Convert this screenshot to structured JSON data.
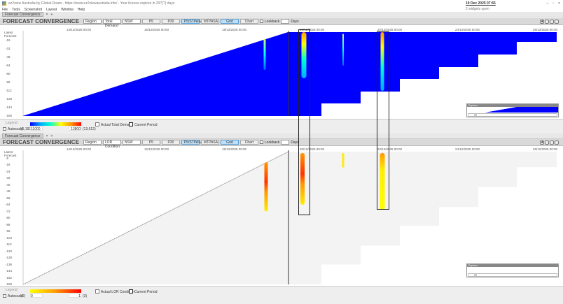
{
  "window": {
    "title": "ez2view Australia by Global-Roam - https://www.ez2viewaustralia.info/ - Your licence expires in 29?(?) days",
    "datetime": "19 Dec 2025 07:55",
    "widgets_open": "2 widgets open"
  },
  "menu": [
    "File",
    "Tools",
    "Screenshot",
    "Layout",
    "Window",
    "Help"
  ],
  "tabs": {
    "label": "Forecast Convergence",
    "active": "Forecast Convergence"
  },
  "panels": [
    {
      "title": "FORECAST CONVERGENCE",
      "region": "Region",
      "measure": "Total Demand",
      "state": "NSW",
      "buttons": [
        "P5",
        "P30",
        "P5/STPASA",
        "MTPASA"
      ],
      "active_button": "P5/STPASA",
      "view": [
        "Grid",
        "Chart"
      ],
      "active_view": "Grid",
      "lookback": "Lookback",
      "lookback_unit": "Days",
      "y_title": "Latest Forecast",
      "y_ticks": [
        "-16",
        "-32",
        "-48",
        "-64",
        "-80",
        "-96",
        "-112",
        "-128",
        "-144",
        "-160"
      ],
      "x_ticks": [
        "14/12/2025 00:00",
        "16/12/2025 00:00",
        "18/12/2025 00:00",
        "20/12/2025 00:00",
        "22/12/2025 00:00",
        "24/12/2025 00:00",
        "26/12/2025 00:00"
      ],
      "legend": {
        "title": "Legend",
        "autoscale": "Autoscale",
        "min_paren": "(5,193)",
        "min": "11000",
        "max": "13800",
        "max_paren": "(13,612)",
        "actual": "Actual Total Demand",
        "current": "Current Period",
        "colors": [
          "#0000ff",
          "#00ffff",
          "#ffff00",
          "#ff0000"
        ]
      },
      "explorer": "Explorer"
    },
    {
      "title": "FORECAST CONVERGENCE",
      "region": "Region",
      "measure": "LOR Condition",
      "state": "NSW",
      "buttons": [
        "P5",
        "P30",
        "P5/STPASA",
        "MTPASA"
      ],
      "active_button": "P5/STPASA",
      "view": [
        "Grid",
        "Chart"
      ],
      "active_view": "Grid",
      "lookback": "Lookback",
      "lookback_unit": "Days",
      "y_title": "Latest Forecast",
      "y_ticks": [
        "-8",
        "-16",
        "-24",
        "-32",
        "-40",
        "-48",
        "-56",
        "-64",
        "-72",
        "-80",
        "-88",
        "-96",
        "-104",
        "-112",
        "-120",
        "-128",
        "-136",
        "-144",
        "-152",
        "-160"
      ],
      "x_ticks": [
        "14/12/2025 00:00",
        "16/12/2025 00:00",
        "18/12/2025 00:00",
        "20/12/2025 00:00",
        "22/12/2025 00:00",
        "24/12/2025 00:00",
        "26/12/2025 00:00"
      ],
      "legend": {
        "title": "Legend",
        "autoscale": "Autoscale",
        "min_paren": "(0)",
        "min": "0",
        "max": "1",
        "max_paren": "(3)",
        "actual": "Actual LOR Condition",
        "current": "Current Period",
        "colors": [
          "#ffff00",
          "#ff9900",
          "#ff0000"
        ]
      },
      "explorer": "Explorer"
    }
  ]
}
